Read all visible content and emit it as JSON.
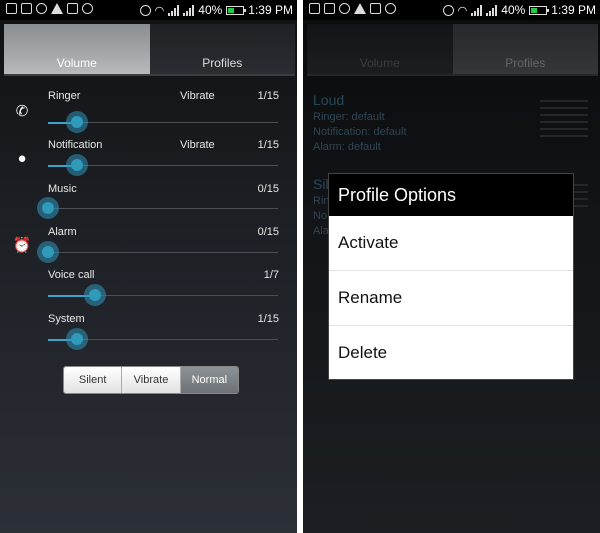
{
  "status_bar": {
    "battery": "40%",
    "time": "1:39 PM"
  },
  "left": {
    "tabs": [
      {
        "label": "Volume"
      },
      {
        "label": "Profiles"
      }
    ],
    "sliders": [
      {
        "label": "Ringer",
        "mode": "Vibrate",
        "value": "1/15",
        "level": 0.067,
        "icon": "phone-icon"
      },
      {
        "label": "Notification",
        "mode": "Vibrate",
        "value": "1/15",
        "level": 0.067,
        "icon": "notification-icon"
      },
      {
        "label": "Music",
        "mode": "",
        "value": "0/15",
        "level": 0.0,
        "icon": ""
      },
      {
        "label": "Alarm",
        "mode": "",
        "value": "0/15",
        "level": 0.0,
        "icon": "alarm-icon"
      },
      {
        "label": "Voice call",
        "mode": "",
        "value": "1/7",
        "level": 0.143,
        "icon": ""
      },
      {
        "label": "System",
        "mode": "",
        "value": "1/15",
        "level": 0.067,
        "icon": ""
      }
    ],
    "modes": [
      "Silent",
      "Vibrate",
      "Normal"
    ],
    "selected_mode": "Normal"
  },
  "right": {
    "tabs": [
      {
        "label": "Volume"
      },
      {
        "label": "Profiles"
      }
    ],
    "profiles": [
      {
        "name": "Loud",
        "lines": [
          "Ringer: default",
          "Notification: default",
          "Alarm: default"
        ]
      },
      {
        "name": "Sil",
        "lines": [
          "Rin",
          "No",
          "Ala"
        ]
      }
    ],
    "dialog": {
      "title": "Profile Options",
      "options": [
        "Activate",
        "Rename",
        "Delete"
      ]
    }
  },
  "colors": {
    "accent": "#2f9ab9",
    "profile_text": "#3d6f8d"
  }
}
